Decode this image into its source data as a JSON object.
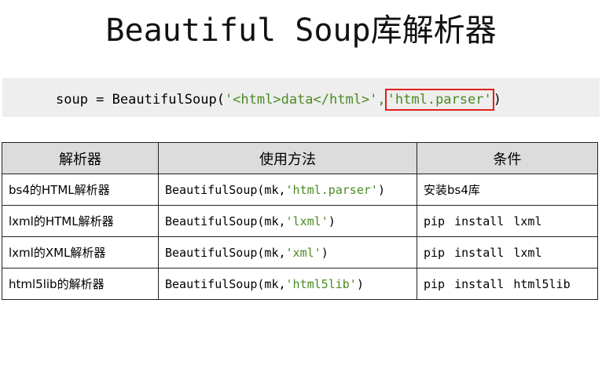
{
  "title": "Beautiful Soup库解析器",
  "code": {
    "prefix": "soup = BeautifulSoup(",
    "arg1": "'<html>data</html>'",
    "sep": ",",
    "arg2": "'html.parser'",
    "suffix": ")"
  },
  "table": {
    "headers": [
      "解析器",
      "使用方法",
      "条件"
    ],
    "rows": [
      {
        "parser": "bs4的HTML解析器",
        "usage_prefix": "BeautifulSoup(mk,",
        "usage_arg": "'html.parser'",
        "usage_suffix": ")",
        "condition": "安装bs4库"
      },
      {
        "parser": "lxml的HTML解析器",
        "usage_prefix": "BeautifulSoup(mk,",
        "usage_arg": "'lxml'",
        "usage_suffix": ")",
        "condition": "pip install lxml"
      },
      {
        "parser": "lxml的XML解析器",
        "usage_prefix": "BeautifulSoup(mk,",
        "usage_arg": "'xml'",
        "usage_suffix": ")",
        "condition": "pip install lxml"
      },
      {
        "parser": "html5lib的解析器",
        "usage_prefix": "BeautifulSoup(mk,",
        "usage_arg": "'html5lib'",
        "usage_suffix": ")",
        "condition": "pip install html5lib"
      }
    ]
  },
  "colors": {
    "string": "#4a8a22",
    "highlight_border": "#e0201a",
    "header_bg": "#dcdcdc",
    "code_bg": "#eeeeee"
  }
}
